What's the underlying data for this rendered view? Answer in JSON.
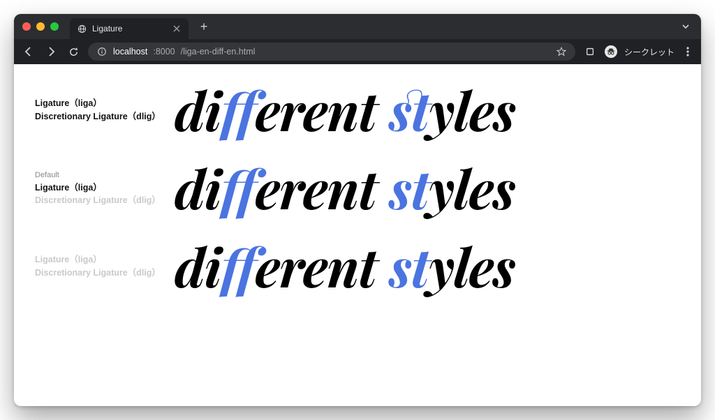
{
  "window": {
    "tab_title": "Ligature",
    "new_tab_glyph": "+",
    "incognito_label": "シークレット"
  },
  "address_bar": {
    "host": "localhost",
    "port": ":8000",
    "path": "/liga-en-diff-en.html"
  },
  "rows": [
    {
      "labels": {
        "pretitle": "",
        "line1": "Ligature（liga）",
        "line1_dim": false,
        "line2": "Discretionary Ligature（dlig）",
        "line2_dim": false
      },
      "sample": {
        "p1": "di",
        "h1": "ff",
        "p2": "erent ",
        "h2": "st",
        "p3": "yles"
      }
    },
    {
      "labels": {
        "pretitle": "Default",
        "line1": "Ligature（liga）",
        "line1_dim": false,
        "line2": "Discretionary Ligature（dlig）",
        "line2_dim": true
      },
      "sample": {
        "p1": "di",
        "h1": "ff",
        "p2": "erent ",
        "h2": "st",
        "p3": "yles"
      }
    },
    {
      "labels": {
        "pretitle": "",
        "line1": "Ligature（liga）",
        "line1_dim": true,
        "line2": "Discretionary Ligature（dlig）",
        "line2_dim": true
      },
      "sample": {
        "p1": "di",
        "h1": "ff",
        "p2": "erent ",
        "h2": "st",
        "p3": "yles"
      }
    }
  ],
  "colors": {
    "highlight": "#4b74e0",
    "chrome_bg": "#202124",
    "tabstrip_bg": "#2b2d30",
    "omnibox_bg": "#35363a"
  }
}
